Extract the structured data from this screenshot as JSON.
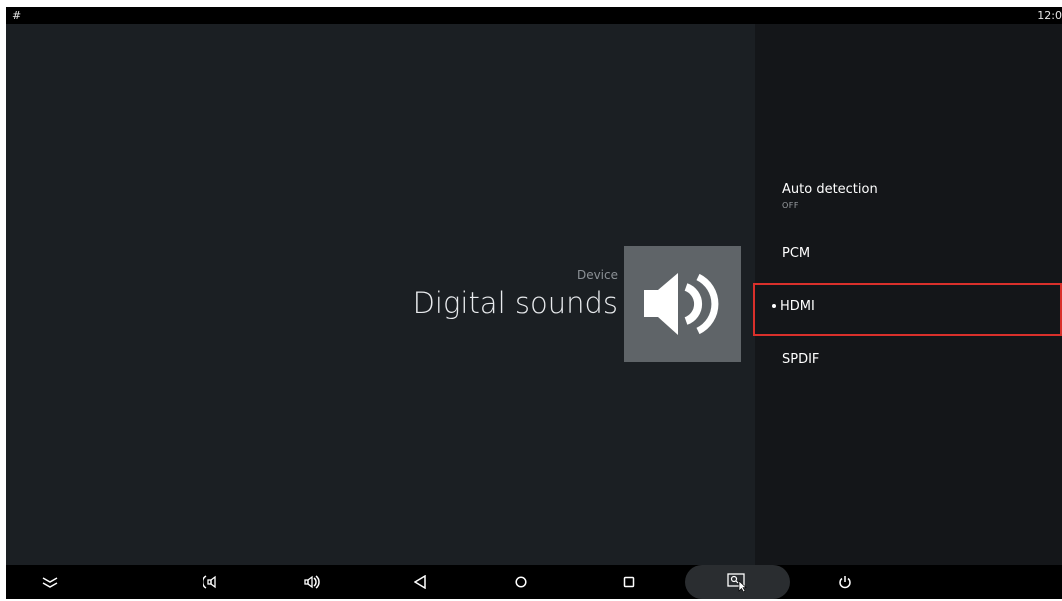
{
  "status_bar": {
    "left_text": "#",
    "time": "12:0"
  },
  "main": {
    "category_label": "Device",
    "title": "Digital sounds",
    "tile_icon": "speaker-volume-icon"
  },
  "options": [
    {
      "label": "Auto detection",
      "sublabel": "OFF",
      "selected": false
    },
    {
      "label": "PCM",
      "sublabel": "",
      "selected": false
    },
    {
      "label": "HDMI",
      "sublabel": "",
      "selected": true
    },
    {
      "label": "SPDIF",
      "sublabel": "",
      "selected": false
    }
  ],
  "nav_bar": {
    "buttons": [
      "collapse-icon",
      "volume-down-icon",
      "volume-up-icon",
      "back-icon",
      "home-icon",
      "recents-icon",
      "screenshot-icon",
      "power-icon"
    ],
    "highlighted": "screenshot-icon"
  },
  "colors": {
    "selection_border": "#d9302b",
    "tile_background": "#5f6468"
  }
}
